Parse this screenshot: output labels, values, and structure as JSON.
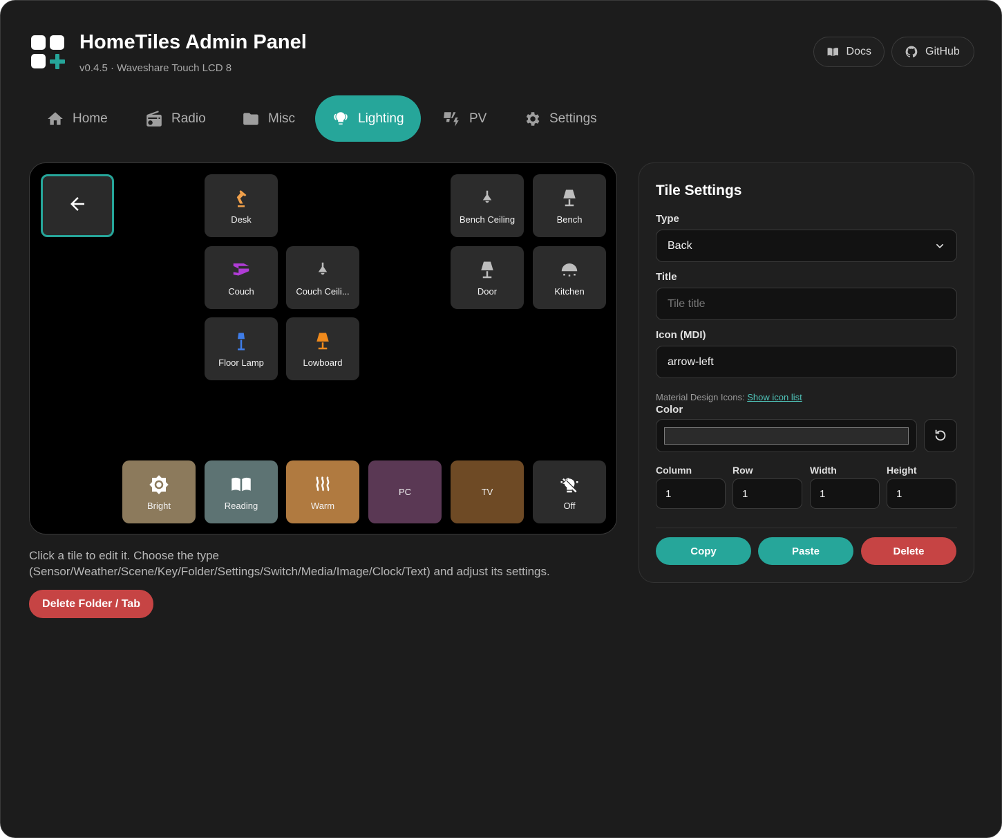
{
  "app": {
    "title": "HomeTiles Admin Panel",
    "subtitle": "v0.4.5 · Waveshare Touch LCD 8",
    "accent": "#26a69a"
  },
  "header": {
    "docs_label": "Docs",
    "github_label": "GitHub"
  },
  "tabs": [
    {
      "label": "Home",
      "icon": "home-icon"
    },
    {
      "label": "Radio",
      "icon": "radio-icon"
    },
    {
      "label": "Misc",
      "icon": "folder-icon"
    },
    {
      "label": "Lighting",
      "icon": "lightbulb-group-icon",
      "active": true
    },
    {
      "label": "PV",
      "icon": "solar-panel-icon"
    },
    {
      "label": "Settings",
      "icon": "gear-icon"
    }
  ],
  "tiles": [
    {
      "label": "",
      "icon": "arrow-left-icon",
      "selected": true
    },
    {
      "label": "Desk",
      "icon": "desk-lamp-icon",
      "color": "#f0a04b"
    },
    {
      "label": "Bench Ceiling",
      "icon": "ceiling-light-icon"
    },
    {
      "label": "Bench",
      "icon": "lamp-icon"
    },
    {
      "label": "Couch",
      "icon": "led-strip-icon",
      "color": "#b03cd6"
    },
    {
      "label": "Couch Ceili...",
      "icon": "ceiling-light-icon"
    },
    {
      "label": "Door",
      "icon": "lamp-icon"
    },
    {
      "label": "Kitchen",
      "icon": "ceiling-light-dots-icon"
    },
    {
      "label": "Floor Lamp",
      "icon": "floor-lamp-icon",
      "color": "#3f7de8"
    },
    {
      "label": "Lowboard",
      "icon": "lamp-icon",
      "color": "#f08a1c"
    },
    {
      "label": "Bright",
      "icon": "brightness-icon",
      "bg": "#8c7a5c"
    },
    {
      "label": "Reading",
      "icon": "book-open-icon",
      "bg": "#5d7373"
    },
    {
      "label": "Warm",
      "icon": "heat-waves-icon",
      "bg": "#b07a40"
    },
    {
      "label": "PC",
      "bg": "#5a3854"
    },
    {
      "label": "TV",
      "bg": "#6e4a25"
    },
    {
      "label": "Off",
      "icon": "lightbulb-off-icon",
      "bg": "#2c2c2c"
    }
  ],
  "help_text": "Click a tile to edit it. Choose the type (Sensor/Weather/Scene/Key/Folder/Settings/Switch/Media/Image/Clock/Text) and adjust its settings.",
  "delete_folder_label": "Delete Folder / Tab",
  "settings": {
    "title": "Tile Settings",
    "type_label": "Type",
    "type_value": "Back",
    "title_label": "Title",
    "title_placeholder": "Tile title",
    "icon_label": "Icon (MDI)",
    "icon_value": "arrow-left",
    "hint_prefix": "Material Design Icons: ",
    "hint_link": "Show icon list",
    "color_label": "Color",
    "color_value": "#2b2b2b",
    "column_label": "Column",
    "column_value": "1",
    "row_label": "Row",
    "row_value": "1",
    "width_label": "Width",
    "width_value": "1",
    "height_label": "Height",
    "height_value": "1",
    "copy_label": "Copy",
    "paste_label": "Paste",
    "delete_label": "Delete",
    "danger_color": "#c64444"
  }
}
